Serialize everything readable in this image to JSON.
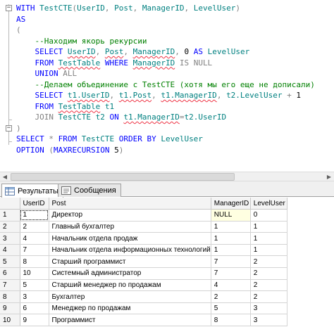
{
  "editor": {
    "lines": [
      {
        "indent": 0,
        "tokens": [
          {
            "t": "WITH ",
            "c": "kw"
          },
          {
            "t": "TestCTE",
            "c": "obj"
          },
          {
            "t": "(",
            "c": "kwg"
          },
          {
            "t": "UserID",
            "c": "obj"
          },
          {
            "t": ", ",
            "c": "kwg"
          },
          {
            "t": "Post",
            "c": "obj"
          },
          {
            "t": ", ",
            "c": "kwg"
          },
          {
            "t": "ManagerID",
            "c": "obj"
          },
          {
            "t": ", ",
            "c": "kwg"
          },
          {
            "t": "LevelUser",
            "c": "obj"
          },
          {
            "t": ")",
            "c": "kwg"
          }
        ]
      },
      {
        "indent": 0,
        "tokens": [
          {
            "t": "AS",
            "c": "kw"
          }
        ]
      },
      {
        "indent": 0,
        "tokens": [
          {
            "t": "(",
            "c": "kwg"
          }
        ]
      },
      {
        "indent": 4,
        "tokens": [
          {
            "t": "--Находим якорь рекурсии",
            "c": "cmt"
          }
        ]
      },
      {
        "indent": 4,
        "tokens": [
          {
            "t": "SELECT ",
            "c": "kw"
          },
          {
            "t": "UserID",
            "c": "obj sq"
          },
          {
            "t": ", ",
            "c": "kwg"
          },
          {
            "t": "Post",
            "c": "obj sq"
          },
          {
            "t": ", ",
            "c": "kwg"
          },
          {
            "t": "ManagerID",
            "c": "obj sq"
          },
          {
            "t": ", ",
            "c": "kwg"
          },
          {
            "t": "0 ",
            "c": "num"
          },
          {
            "t": "AS ",
            "c": "kw"
          },
          {
            "t": "LevelUser",
            "c": "obj"
          }
        ]
      },
      {
        "indent": 4,
        "tokens": [
          {
            "t": "FROM ",
            "c": "kw"
          },
          {
            "t": "TestTable",
            "c": "obj sq"
          },
          {
            "t": " WHERE ",
            "c": "kw"
          },
          {
            "t": "ManagerID",
            "c": "obj sq"
          },
          {
            "t": " IS NULL",
            "c": "kwg"
          }
        ]
      },
      {
        "indent": 4,
        "tokens": [
          {
            "t": "UNION ",
            "c": "kw"
          },
          {
            "t": "ALL",
            "c": "kwg"
          }
        ]
      },
      {
        "indent": 4,
        "tokens": [
          {
            "t": "--Делаем объединение с TestCTE (хотя мы его еще не дописали)",
            "c": "cmt"
          }
        ]
      },
      {
        "indent": 4,
        "tokens": [
          {
            "t": "SELECT ",
            "c": "kw"
          },
          {
            "t": "t1.UserID",
            "c": "obj sq"
          },
          {
            "t": ", ",
            "c": "kwg"
          },
          {
            "t": "t1.Post",
            "c": "obj sq"
          },
          {
            "t": ", ",
            "c": "kwg"
          },
          {
            "t": "t1.ManagerID",
            "c": "obj sq"
          },
          {
            "t": ", ",
            "c": "kwg"
          },
          {
            "t": "t2.LevelUser",
            "c": "obj"
          },
          {
            "t": " + ",
            "c": "kwg"
          },
          {
            "t": "1",
            "c": "num"
          }
        ]
      },
      {
        "indent": 4,
        "tokens": [
          {
            "t": "FROM ",
            "c": "kw"
          },
          {
            "t": "TestTable",
            "c": "obj sq"
          },
          {
            "t": " t1",
            "c": "obj"
          }
        ]
      },
      {
        "indent": 4,
        "tokens": [
          {
            "t": "JOIN ",
            "c": "kwg"
          },
          {
            "t": "TestCTE t2 ",
            "c": "obj"
          },
          {
            "t": "ON ",
            "c": "kw"
          },
          {
            "t": "t1.ManagerID",
            "c": "obj sq"
          },
          {
            "t": "=",
            "c": "kwg"
          },
          {
            "t": "t2.UserID",
            "c": "obj"
          }
        ]
      },
      {
        "indent": 0,
        "tokens": [
          {
            "t": ")",
            "c": "kwg"
          }
        ]
      },
      {
        "indent": 0,
        "tokens": [
          {
            "t": "SELECT ",
            "c": "kw"
          },
          {
            "t": "* ",
            "c": "kwg"
          },
          {
            "t": "FROM ",
            "c": "kw"
          },
          {
            "t": "TestCTE ",
            "c": "obj"
          },
          {
            "t": "ORDER BY ",
            "c": "kw"
          },
          {
            "t": "LevelUser",
            "c": "obj"
          }
        ]
      },
      {
        "indent": 0,
        "tokens": [
          {
            "t": "OPTION ",
            "c": "kw"
          },
          {
            "t": "(",
            "c": "kwg"
          },
          {
            "t": "MAXRECURSION ",
            "c": "kw"
          },
          {
            "t": "5",
            "c": "num"
          },
          {
            "t": ")",
            "c": "kwg"
          }
        ]
      }
    ]
  },
  "tabs": [
    {
      "label": "Результаты",
      "icon": "grid-icon",
      "active": true
    },
    {
      "label": "Сообщения",
      "icon": "messages-icon",
      "active": false
    }
  ],
  "grid": {
    "columns": [
      "UserID",
      "Post",
      "ManagerID",
      "LevelUser"
    ],
    "rows": [
      {
        "n": "1",
        "cells": [
          "1",
          "Директор",
          "NULL",
          "0"
        ]
      },
      {
        "n": "2",
        "cells": [
          "2",
          "Главный бухгалтер",
          "1",
          "1"
        ]
      },
      {
        "n": "3",
        "cells": [
          "4",
          "Начальник отдела продаж",
          "1",
          "1"
        ]
      },
      {
        "n": "4",
        "cells": [
          "7",
          "Начальник отдела информационных технологий",
          "1",
          "1"
        ]
      },
      {
        "n": "5",
        "cells": [
          "8",
          "Старший программист",
          "7",
          "2"
        ]
      },
      {
        "n": "6",
        "cells": [
          "10",
          "Системный администратор",
          "7",
          "2"
        ]
      },
      {
        "n": "7",
        "cells": [
          "5",
          "Старший менеджер по продажам",
          "4",
          "2"
        ]
      },
      {
        "n": "8",
        "cells": [
          "3",
          "Бухгалтер",
          "2",
          "2"
        ]
      },
      {
        "n": "9",
        "cells": [
          "6",
          "Менеджер по продажам",
          "5",
          "3"
        ]
      },
      {
        "n": "10",
        "cells": [
          "9",
          "Программист",
          "8",
          "3"
        ]
      }
    ]
  },
  "colors": {
    "keyword": "#0000ff",
    "object": "#008080",
    "comment": "#008000",
    "operator": "#808080",
    "null_cell": "#ffffe1"
  }
}
